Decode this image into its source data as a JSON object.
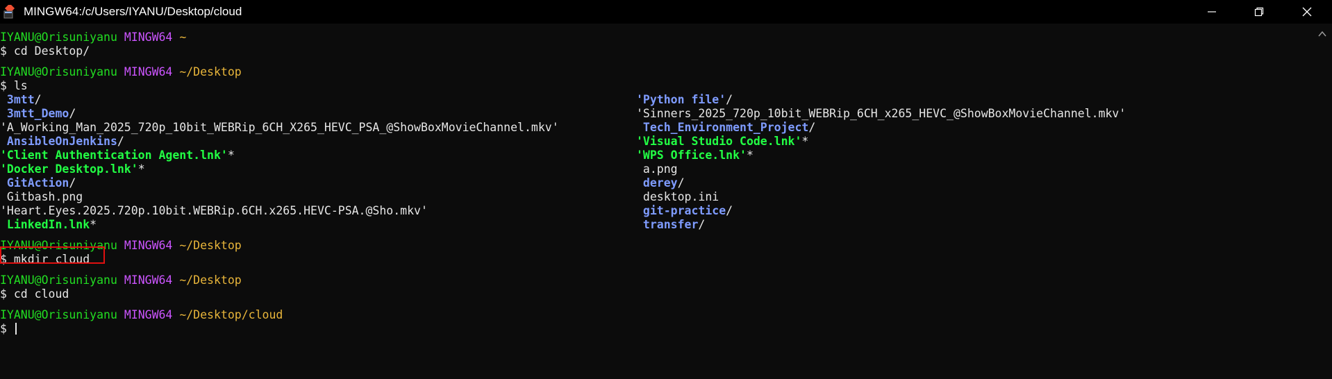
{
  "window": {
    "title": "MINGW64:/c/Users/IYANU/Desktop/cloud",
    "minimize_label": "─",
    "close_label": "✕"
  },
  "prompt": {
    "user": "IYANU@Orisuniyanu",
    "host": "MINGW64"
  },
  "terminal": {
    "blocks": [
      {
        "path": "~",
        "command": "$ cd Desktop/"
      },
      {
        "path": "~/Desktop",
        "command": "$ ls"
      },
      {
        "path": "~/Desktop",
        "command": "$ mkdir cloud"
      },
      {
        "path": "~/Desktop",
        "command": "$ cd cloud"
      },
      {
        "path": "~/Desktop/cloud",
        "command": "$ "
      }
    ],
    "ls_left": [
      {
        "name": " 3mtt",
        "suffix": "/",
        "kind": "dir"
      },
      {
        "name": " 3mtt_Demo",
        "suffix": "/",
        "kind": "dir"
      },
      {
        "name": "'A_Working_Man_2025_720p_10bit_WEBRip_6CH_X265_HEVC_PSA_@ShowBoxMovieChannel.mkv'",
        "suffix": "",
        "kind": "file"
      },
      {
        "name": " AnsibleOnJenkins",
        "suffix": "/",
        "kind": "dir"
      },
      {
        "name": "'Client Authentication Agent.lnk'",
        "suffix": "*",
        "kind": "exe"
      },
      {
        "name": "'Docker Desktop.lnk'",
        "suffix": "*",
        "kind": "exe"
      },
      {
        "name": " GitAction",
        "suffix": "/",
        "kind": "dir"
      },
      {
        "name": " Gitbash.png",
        "suffix": "",
        "kind": "file"
      },
      {
        "name": "'Heart.Eyes.2025.720p.10bit.WEBRip.6CH.x265.HEVC-PSA.@Sho.mkv'",
        "suffix": "",
        "kind": "file"
      },
      {
        "name": " LinkedIn.lnk",
        "suffix": "*",
        "kind": "exe"
      }
    ],
    "ls_right": [
      {
        "name": "'Python file'",
        "suffix": "/",
        "kind": "dir"
      },
      {
        "name": "'Sinners_2025_720p_10bit_WEBRip_6CH_x265_HEVC_@ShowBoxMovieChannel.mkv'",
        "suffix": "",
        "kind": "file"
      },
      {
        "name": " Tech_Environment_Project",
        "suffix": "/",
        "kind": "dir"
      },
      {
        "name": "'Visual Studio Code.lnk'",
        "suffix": "*",
        "kind": "exe"
      },
      {
        "name": "'WPS Office.lnk'",
        "suffix": "*",
        "kind": "exe"
      },
      {
        "name": " a.png",
        "suffix": "",
        "kind": "file"
      },
      {
        "name": " derey",
        "suffix": "/",
        "kind": "dir"
      },
      {
        "name": " desktop.ini",
        "suffix": "",
        "kind": "file"
      },
      {
        "name": " git-practice",
        "suffix": "/",
        "kind": "dir"
      },
      {
        "name": " transfer",
        "suffix": "/",
        "kind": "dir"
      }
    ]
  },
  "colors": {
    "user": "#22dd22",
    "host": "#cc55ff",
    "path": "#e8b53a",
    "directory": "#7f9cff",
    "executable": "#22ff44",
    "highlight": "#e01010"
  }
}
